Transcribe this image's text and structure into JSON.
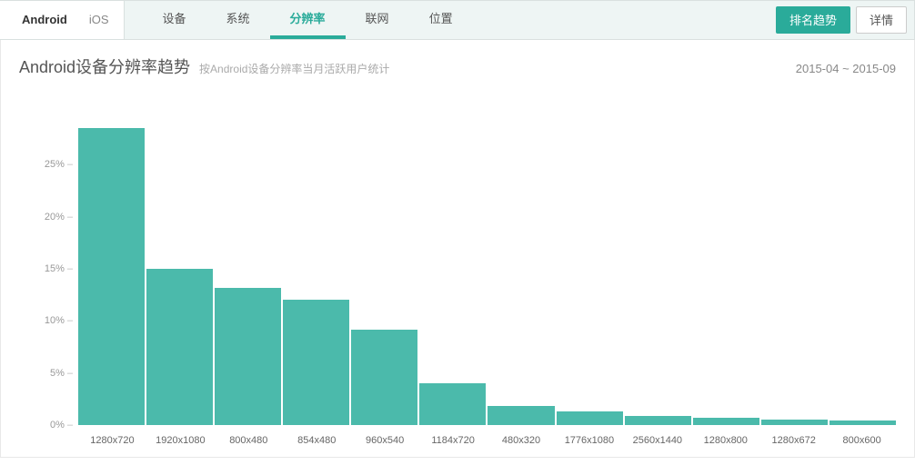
{
  "toolbar": {
    "platform_tabs": [
      "Android",
      "iOS"
    ],
    "platform_active_index": 0,
    "metric_tabs": [
      "设备",
      "系统",
      "分辨率",
      "联网",
      "位置"
    ],
    "metric_active_index": 2,
    "primary_button": "排名趋势",
    "secondary_button": "详情"
  },
  "header": {
    "title": "Android设备分辨率趋势",
    "subtitle": "按Android设备分辨率当月活跃用户统计",
    "daterange": "2015-04 ~ 2015-09"
  },
  "chart_data": {
    "type": "bar",
    "title": "Android设备分辨率趋势",
    "xlabel": "",
    "ylabel": "",
    "ylim": [
      0,
      30
    ],
    "yticks": [
      0,
      5,
      10,
      15,
      20,
      25
    ],
    "ytick_labels": [
      "0%",
      "5%",
      "10%",
      "15%",
      "20%",
      "25%"
    ],
    "categories": [
      "1280x720",
      "1920x1080",
      "800x480",
      "854x480",
      "960x540",
      "1184x720",
      "480x320",
      "1776x1080",
      "2560x1440",
      "1280x800",
      "1280x672",
      "800x600"
    ],
    "values": [
      28.5,
      15.0,
      13.2,
      12.0,
      9.2,
      4.0,
      1.8,
      1.3,
      0.9,
      0.7,
      0.5,
      0.4
    ]
  }
}
